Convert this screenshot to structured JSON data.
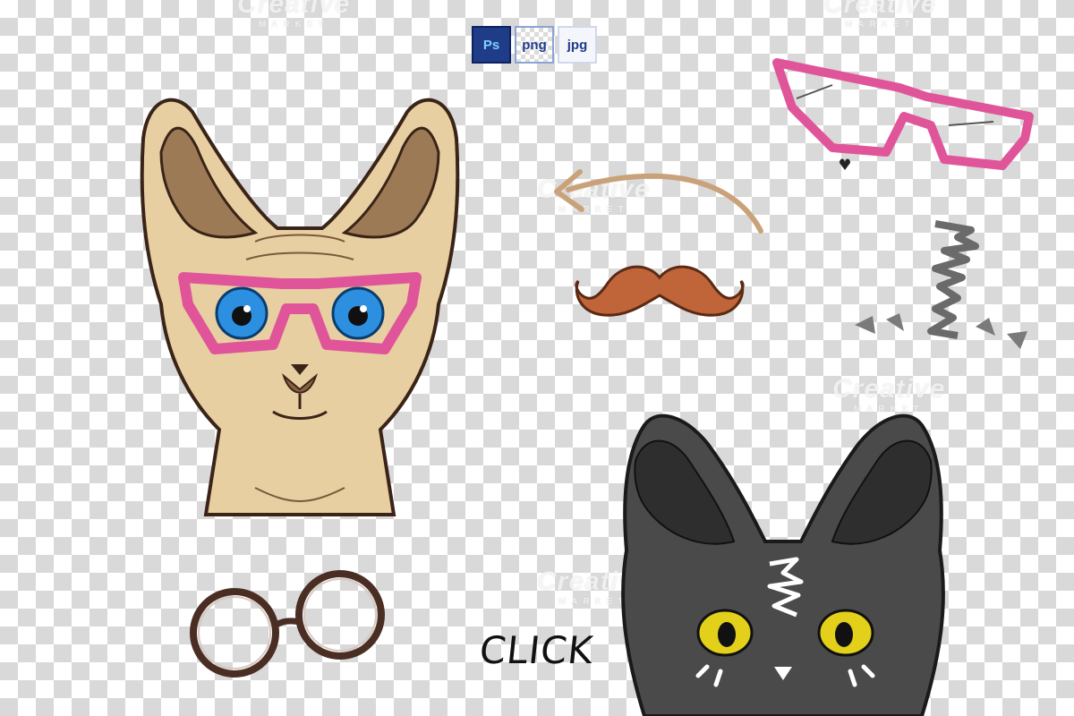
{
  "badges": {
    "ps": "Ps",
    "png": "png",
    "jpg": "jpg"
  },
  "click_text": "CLICK",
  "watermark": {
    "main": "Creative",
    "sub": "MARKET"
  },
  "colors": {
    "checker": "#d9d9d9",
    "pink_glasses": "#e0559a",
    "mustache": "#c0643a",
    "arrow": "#c9a27a",
    "sphynx_skin": "#e8cfa2",
    "black_cat": "#444444",
    "blue_eye": "#2c8fe0",
    "yellow_eye": "#e2d01a"
  },
  "icons": [
    "sphynx-cat-illustration",
    "black-cat-illustration",
    "pink-glasses-icon",
    "round-glasses-icon",
    "mustache-icon",
    "curved-arrow-icon",
    "bow-tie-icon"
  ]
}
